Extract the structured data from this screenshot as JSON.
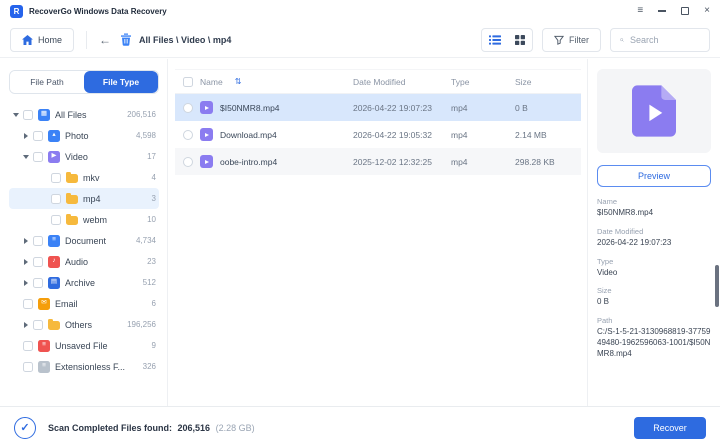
{
  "titlebar": {
    "app_title": "RecoverGo Windows Data Recovery",
    "logo_letter": "R",
    "menu_icon": "≡",
    "close_icon": "×"
  },
  "navbar": {
    "home_label": "Home",
    "back_icon": "←",
    "breadcrumb": "All Files \\ Video \\ mp4",
    "filter_label": "Filter",
    "search_placeholder": "Search"
  },
  "sidebar": {
    "tabs": [
      {
        "label": "File Path",
        "active": false
      },
      {
        "label": "File Type",
        "active": true
      }
    ],
    "tree": [
      {
        "label": "All Files",
        "count": "206,516",
        "level": 0,
        "arrow": "down",
        "glyph": "▦",
        "color": "#3b82f6",
        "folder": false,
        "selected": false
      },
      {
        "label": "Photo",
        "count": "4,598",
        "level": 1,
        "arrow": "right",
        "glyph": "▴",
        "color": "#3b82f6",
        "folder": false,
        "selected": false
      },
      {
        "label": "Video",
        "count": "17",
        "level": 1,
        "arrow": "down",
        "glyph": "▶",
        "color": "#8b7cf0",
        "folder": false,
        "selected": false
      },
      {
        "label": "mkv",
        "count": "4",
        "level": 2,
        "arrow": "none",
        "glyph": "",
        "color": "#f6b93d",
        "folder": true,
        "selected": false
      },
      {
        "label": "mp4",
        "count": "3",
        "level": 2,
        "arrow": "none",
        "glyph": "",
        "color": "#f6b93d",
        "folder": true,
        "selected": true
      },
      {
        "label": "webm",
        "count": "10",
        "level": 2,
        "arrow": "none",
        "glyph": "",
        "color": "#f6b93d",
        "folder": true,
        "selected": false
      },
      {
        "label": "Document",
        "count": "4,734",
        "level": 1,
        "arrow": "right",
        "glyph": "≡",
        "color": "#3b82f6",
        "folder": false,
        "selected": false
      },
      {
        "label": "Audio",
        "count": "23",
        "level": 1,
        "arrow": "right",
        "glyph": "♪",
        "color": "#ef5350",
        "folder": false,
        "selected": false
      },
      {
        "label": "Archive",
        "count": "512",
        "level": 1,
        "arrow": "right",
        "glyph": "▤",
        "color": "#2f6bdf",
        "folder": false,
        "selected": false
      },
      {
        "label": "Email",
        "count": "6",
        "level": 1,
        "arrow": "none",
        "glyph": "✉",
        "color": "#f59e0b",
        "folder": false,
        "selected": false
      },
      {
        "label": "Others",
        "count": "196,256",
        "level": 1,
        "arrow": "right",
        "glyph": "",
        "color": "#f6b93d",
        "folder": true,
        "selected": false
      },
      {
        "label": "Unsaved File",
        "count": "9",
        "level": 1,
        "arrow": "none",
        "glyph": "≡",
        "color": "#ef5350",
        "folder": false,
        "selected": false
      },
      {
        "label": "Extensionless F...",
        "count": "326",
        "level": 1,
        "arrow": "none",
        "glyph": "≡",
        "color": "#b9c2cc",
        "folder": false,
        "selected": false
      }
    ]
  },
  "table": {
    "columns": [
      "Name",
      "Date Modified",
      "Type",
      "Size"
    ],
    "sort_icon": "⇅",
    "rows": [
      {
        "name": "$I50NMR8.mp4",
        "date": "2026-04-22 19:07:23",
        "type": "mp4",
        "size": "0 B",
        "selected": true
      },
      {
        "name": "Download.mp4",
        "date": "2026-04-22 19:05:32",
        "type": "mp4",
        "size": "2.14 MB",
        "selected": false
      },
      {
        "name": "oobe-intro.mp4",
        "date": "2025-12-02 12:32:25",
        "type": "mp4",
        "size": "298.28 KB",
        "selected": false
      }
    ]
  },
  "details": {
    "preview_label": "Preview",
    "fields": [
      {
        "label": "Name",
        "value": "$I50NMR8.mp4"
      },
      {
        "label": "Date Modified",
        "value": "2026-04-22 19:07:23"
      },
      {
        "label": "Type",
        "value": "Video"
      },
      {
        "label": "Size",
        "value": "0 B"
      },
      {
        "label": "Path",
        "value": "C:/S-1-5-21-3130968819-3775949480-1962596063-1001/$I50NMR8.mp4"
      }
    ]
  },
  "footer": {
    "check_icon": "✓",
    "status_label": "Scan Completed Files found:",
    "files_found": "206,516",
    "total_size": "(2.28 GB)",
    "recover_label": "Recover"
  },
  "colors": {
    "accent_blue": "#2e6be0",
    "video_purple": "#8b7cf0",
    "selected_row": "#d8e7fc",
    "folder_yellow": "#f6b93d"
  }
}
